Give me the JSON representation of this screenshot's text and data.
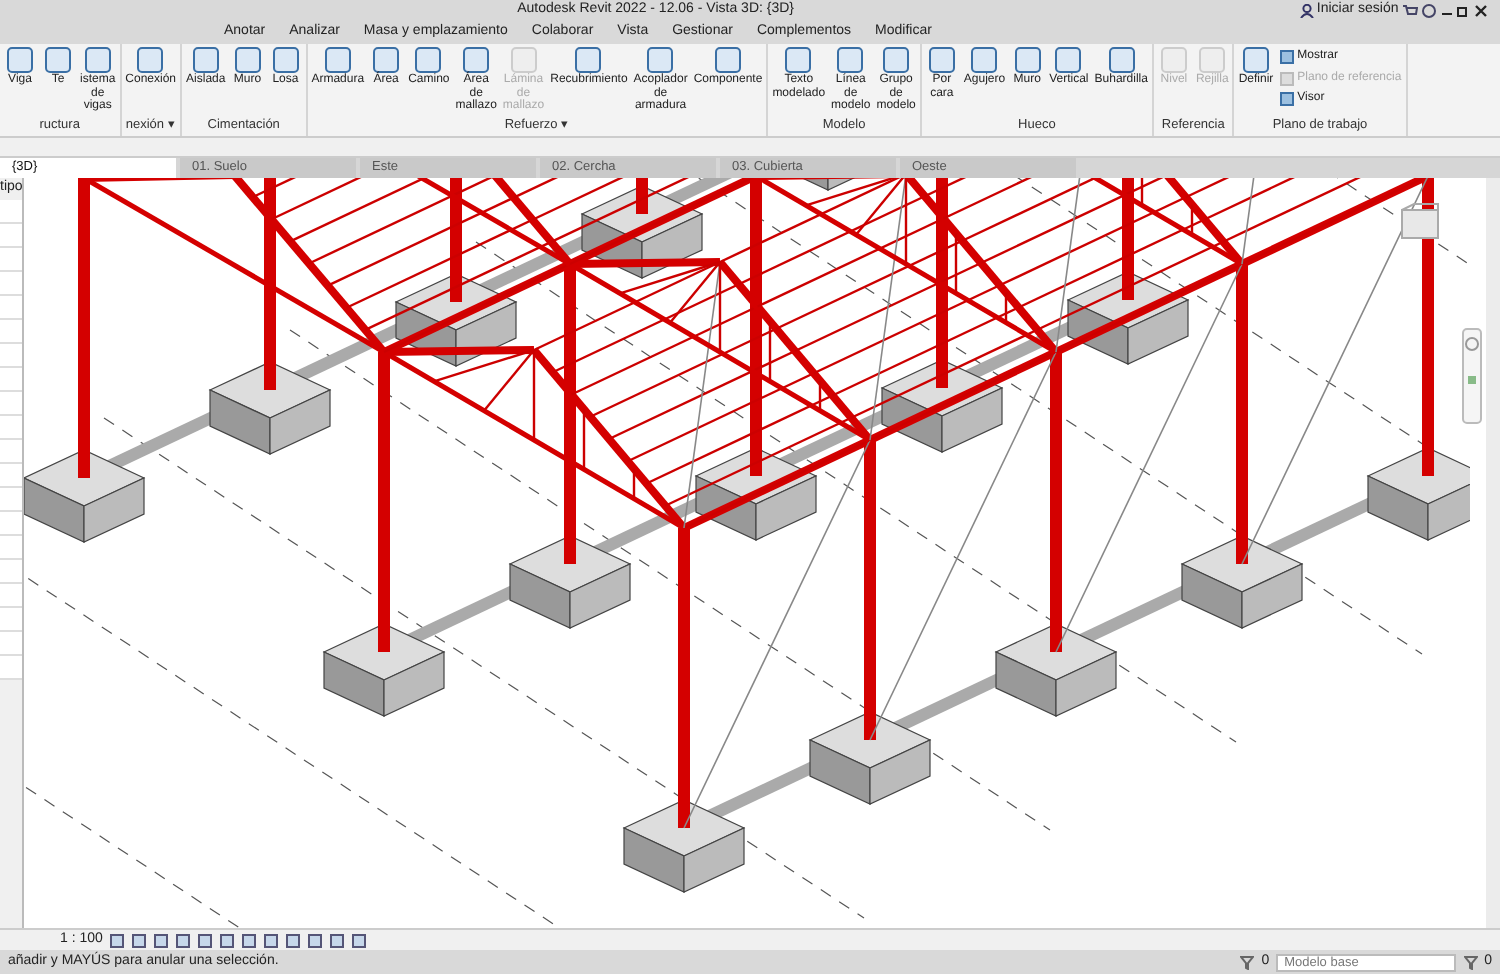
{
  "window": {
    "title": "Autodesk Revit 2022 - 12.06 - Vista 3D: {3D}",
    "sign_in": "Iniciar sesión"
  },
  "menu": [
    "Anotar",
    "Analizar",
    "Masa y emplazamiento",
    "Colaborar",
    "Vista",
    "Gestionar",
    "Complementos",
    "Modificar"
  ],
  "ribbon": [
    {
      "label": "ructura",
      "tools": [
        {
          "label": "Viga",
          "kind": "large",
          "disabled": false
        },
        {
          "label": "Te",
          "kind": "large",
          "disabled": false
        },
        {
          "label": "istema de vigas",
          "kind": "large",
          "disabled": false
        }
      ]
    },
    {
      "label": "nexión ▾",
      "tools": [
        {
          "label": "Conexión",
          "kind": "large",
          "disabled": false
        }
      ]
    },
    {
      "label": "Cimentación",
      "tools": [
        {
          "label": "Aislada",
          "kind": "large",
          "disabled": false
        },
        {
          "label": "Muro",
          "kind": "large",
          "disabled": false
        },
        {
          "label": "Losa",
          "kind": "large",
          "disabled": false
        }
      ]
    },
    {
      "label": "Refuerzo ▾",
      "tools": [
        {
          "label": "Armadura",
          "kind": "large",
          "disabled": false
        },
        {
          "label": "Área",
          "kind": "large",
          "disabled": false
        },
        {
          "label": "Camino",
          "kind": "large",
          "disabled": false
        },
        {
          "label": "Área de mallazo",
          "kind": "large",
          "disabled": false
        },
        {
          "label": "Lámina de mallazo",
          "kind": "large",
          "disabled": true
        },
        {
          "label": "Recubrimiento",
          "kind": "large",
          "disabled": false
        },
        {
          "label": "Acoplador de armadura",
          "kind": "large",
          "disabled": false
        },
        {
          "label": "Componente",
          "kind": "large",
          "disabled": false
        }
      ]
    },
    {
      "label": "Modelo",
      "tools": [
        {
          "label": "Texto modelado",
          "kind": "large",
          "disabled": false
        },
        {
          "label": "Línea de modelo",
          "kind": "large",
          "disabled": false
        },
        {
          "label": "Grupo de modelo",
          "kind": "large",
          "disabled": false
        }
      ]
    },
    {
      "label": "Hueco",
      "tools": [
        {
          "label": "Por cara",
          "kind": "large",
          "disabled": false
        },
        {
          "label": "Agujero",
          "kind": "large",
          "disabled": false
        },
        {
          "label": "Muro",
          "kind": "large",
          "disabled": false
        },
        {
          "label": "Vertical",
          "kind": "large",
          "disabled": false
        },
        {
          "label": "Buhardilla",
          "kind": "large",
          "disabled": false
        }
      ]
    },
    {
      "label": "Referencia",
      "tools": [
        {
          "label": "Nivel",
          "kind": "large",
          "disabled": true
        },
        {
          "label": "Rejilla",
          "kind": "large",
          "disabled": true
        }
      ]
    },
    {
      "label": "Plano de trabajo",
      "tools": [
        {
          "label": "Definir",
          "kind": "large",
          "disabled": false
        },
        {
          "label": "Mostrar",
          "kind": "small",
          "disabled": false
        },
        {
          "label": "Plano de referencia",
          "kind": "small",
          "disabled": true
        },
        {
          "label": "Visor",
          "kind": "small",
          "disabled": false
        }
      ]
    }
  ],
  "view_tabs": [
    {
      "label": "{3D}",
      "selected": true
    },
    {
      "label": "01. Suelo",
      "selected": false
    },
    {
      "label": "Este",
      "selected": false
    },
    {
      "label": "02. Cercha",
      "selected": false
    },
    {
      "label": "03. Cubierta",
      "selected": false
    },
    {
      "label": "Oeste",
      "selected": false
    }
  ],
  "properties": {
    "label": "tipo"
  },
  "view_bar": {
    "scale": "1 : 100"
  },
  "status_bar": {
    "message": "añadir y MAYÚS para anular una selección.",
    "selection_count": "0",
    "model": "Modelo base",
    "filter_count": "0"
  }
}
